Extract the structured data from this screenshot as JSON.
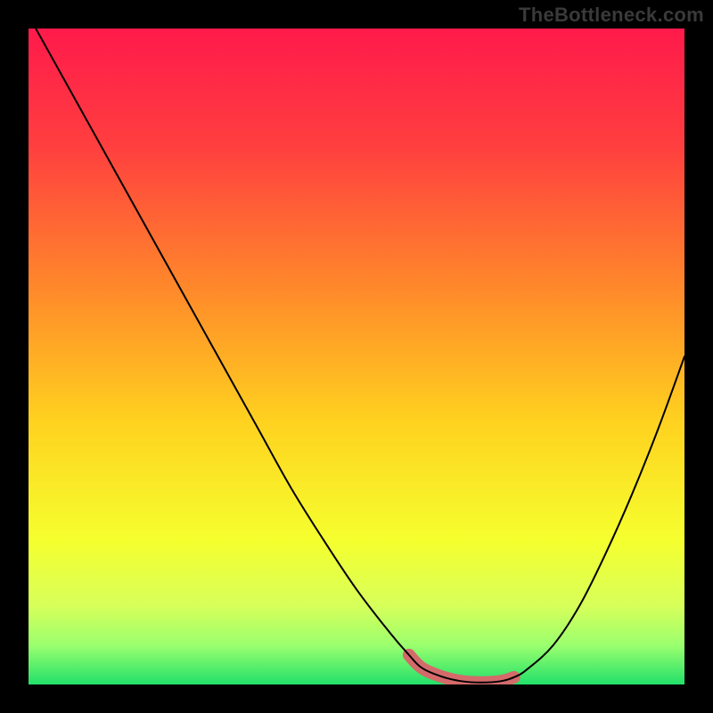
{
  "watermark": "TheBottleneck.com",
  "chart_data": {
    "type": "line",
    "title": "",
    "xlabel": "",
    "ylabel": "",
    "xlim": [
      0,
      100
    ],
    "ylim": [
      0,
      100
    ],
    "gradient": {
      "stops": [
        {
          "offset": 0,
          "color": "#ff1a4b"
        },
        {
          "offset": 0.18,
          "color": "#ff3f3f"
        },
        {
          "offset": 0.4,
          "color": "#ff8a2a"
        },
        {
          "offset": 0.6,
          "color": "#ffd21f"
        },
        {
          "offset": 0.78,
          "color": "#f5ff2e"
        },
        {
          "offset": 0.88,
          "color": "#d7ff5a"
        },
        {
          "offset": 0.94,
          "color": "#9bff6e"
        },
        {
          "offset": 1.0,
          "color": "#22e06a"
        }
      ]
    },
    "series": [
      {
        "name": "bottleneck-curve",
        "x": [
          0,
          5,
          10,
          15,
          20,
          25,
          30,
          35,
          40,
          45,
          50,
          55,
          58,
          60,
          63,
          66,
          69,
          72,
          74,
          76,
          80,
          84,
          88,
          92,
          96,
          100
        ],
        "y": [
          102,
          93,
          84,
          75,
          66,
          57,
          48,
          39,
          30,
          22,
          14.5,
          8,
          4.5,
          2.5,
          1.2,
          0.5,
          0.3,
          0.5,
          1.1,
          2.3,
          6,
          12,
          20,
          29,
          39,
          50
        ],
        "stroke": "#000000",
        "stroke_width": 2
      }
    ],
    "highlight": {
      "name": "optimal-range",
      "x": [
        58,
        60,
        63,
        66,
        69,
        72,
        74
      ],
      "y": [
        4.5,
        2.5,
        1.2,
        0.5,
        0.3,
        0.5,
        1.1
      ],
      "stroke": "#d46a6a",
      "stroke_width": 14
    }
  }
}
